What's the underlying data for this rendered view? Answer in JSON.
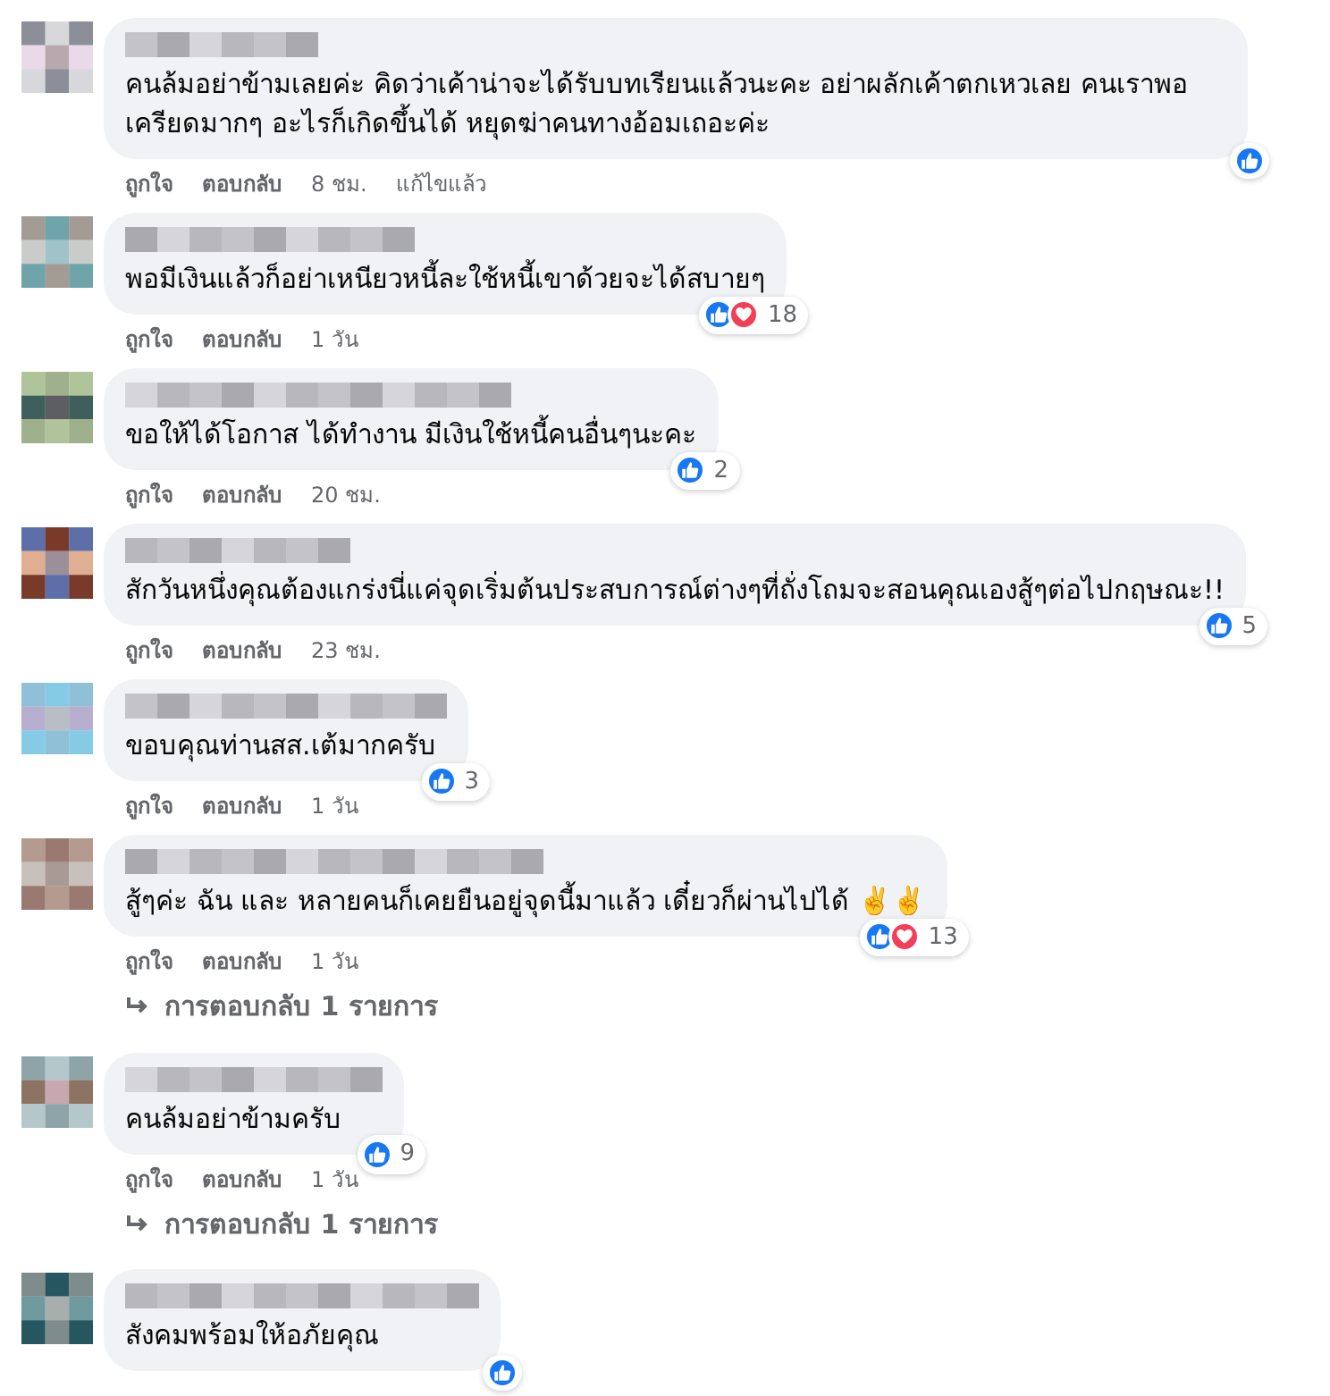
{
  "comments": [
    {
      "text": "คนล้มอย่าข้ามเลยค่ะ คิดว่าเค้าน่าจะได้รับบทเรียนแล้วนะคะ อย่าผลักเค้าตกเหวเลย คนเราพอเครียดมากๆ อะไรก็เกิดขึ้นได้ หยุดฆ่าคนทางอ้อมเถอะค่ะ",
      "reactions": [
        {
          "kind": "like"
        }
      ],
      "actions": [
        "ถูกใจ",
        "ตอบกลับ"
      ],
      "time": "8 ชม.",
      "edited": "แก้ไขแล้ว"
    },
    {
      "text": "พอมีเงินแล้วก็อย่าเหนียวหนี้ละใช้หนี้เขาด้วยจะได้สบายๆ",
      "reactions": [
        {
          "kind": "like"
        },
        {
          "kind": "love"
        }
      ],
      "count": "18",
      "actions": [
        "ถูกใจ",
        "ตอบกลับ"
      ],
      "time": "1 วัน"
    },
    {
      "text": "ขอให้ได้โอกาส ได้ทำงาน มีเงินใช้หนี้คนอื่นๆนะคะ",
      "reactions": [
        {
          "kind": "like"
        }
      ],
      "count": "2",
      "actions": [
        "ถูกใจ",
        "ตอบกลับ"
      ],
      "time": "20 ชม."
    },
    {
      "text": "สักวันหนึ่งคุณต้องแกร่งนี่แค่จุดเริ่มต้นประสบการณ์ต่างๆที่ถั่งโถมจะสอนคุณเองสู้ๆต่อไปกฤษณะ!!",
      "reactions": [
        {
          "kind": "like"
        }
      ],
      "count": "5",
      "actions": [
        "ถูกใจ",
        "ตอบกลับ"
      ],
      "time": "23 ชม."
    },
    {
      "text": "ขอบคุณท่านสส.เต้มากครับ",
      "reactions": [
        {
          "kind": "like"
        }
      ],
      "count": "3",
      "actions": [
        "ถูกใจ",
        "ตอบกลับ"
      ],
      "time": "1 วัน"
    },
    {
      "text": "สู้ๆค่ะ ฉัน และ หลายคนก็เคยยืนอยู่จุดนี้มาแล้ว เดี๋ยวก็ผ่านไปได้ ✌️✌️",
      "reactions": [
        {
          "kind": "like"
        },
        {
          "kind": "love"
        }
      ],
      "count": "13",
      "actions": [
        "ถูกใจ",
        "ตอบกลับ"
      ],
      "time": "1 วัน",
      "replies": "การตอบกลับ 1 รายการ"
    },
    {
      "text": "คนล้มอย่าข้ามครับ",
      "reactions": [
        {
          "kind": "like"
        }
      ],
      "count": "9",
      "actions": [
        "ถูกใจ",
        "ตอบกลับ"
      ],
      "time": "1 วัน",
      "replies": "การตอบกลับ 1 รายการ"
    },
    {
      "text": "สังคมพร้อมให้อภัยคุณ",
      "reactions": [
        {
          "kind": "like"
        }
      ]
    }
  ]
}
